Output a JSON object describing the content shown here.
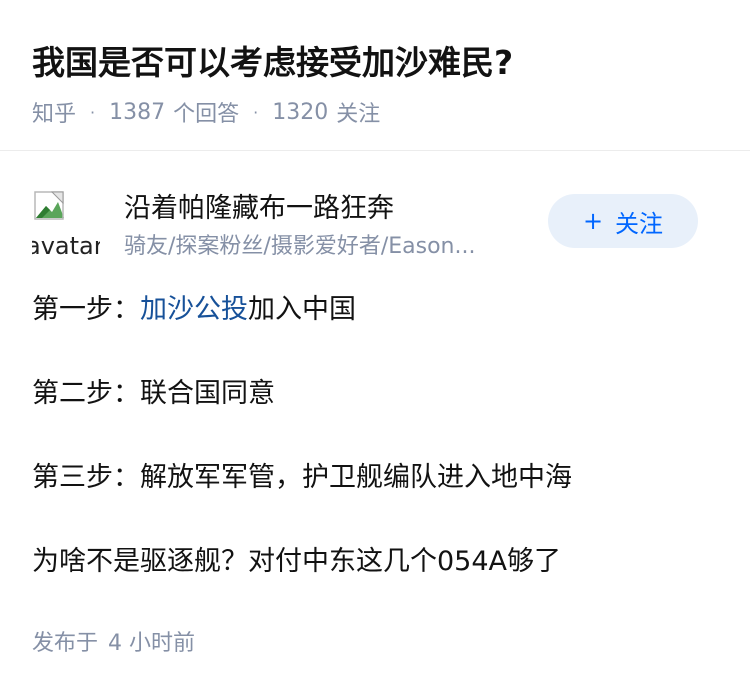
{
  "question": {
    "title": "我国是否可以考虑接受加沙难民?",
    "source": "知乎",
    "answer_count": "1387",
    "answer_label": "个回答",
    "follower_count": "1320",
    "follower_label": "关注"
  },
  "author": {
    "avatar_alt": "avatar",
    "name": "沿着帕隆藏布一路狂奔",
    "bio": "骑友/探案粉丝/摄影爱好者/Eason...",
    "follow_label": "关注"
  },
  "answer": {
    "p1_prefix": "第一步：",
    "p1_link": "加沙公投",
    "p1_suffix": "加入中国",
    "p2": "第二步：联合国同意",
    "p3": "第三步：解放军军管，护卫舰编队进入地中海",
    "p4": "为啥不是驱逐舰？对付中东这几个054A够了"
  },
  "publish": {
    "label": "发布于",
    "time": "4 小时前"
  },
  "colors": {
    "accent": "#0066ff",
    "link": "#175199",
    "meta": "#8590a6",
    "button_bg": "#e8f0fa"
  }
}
